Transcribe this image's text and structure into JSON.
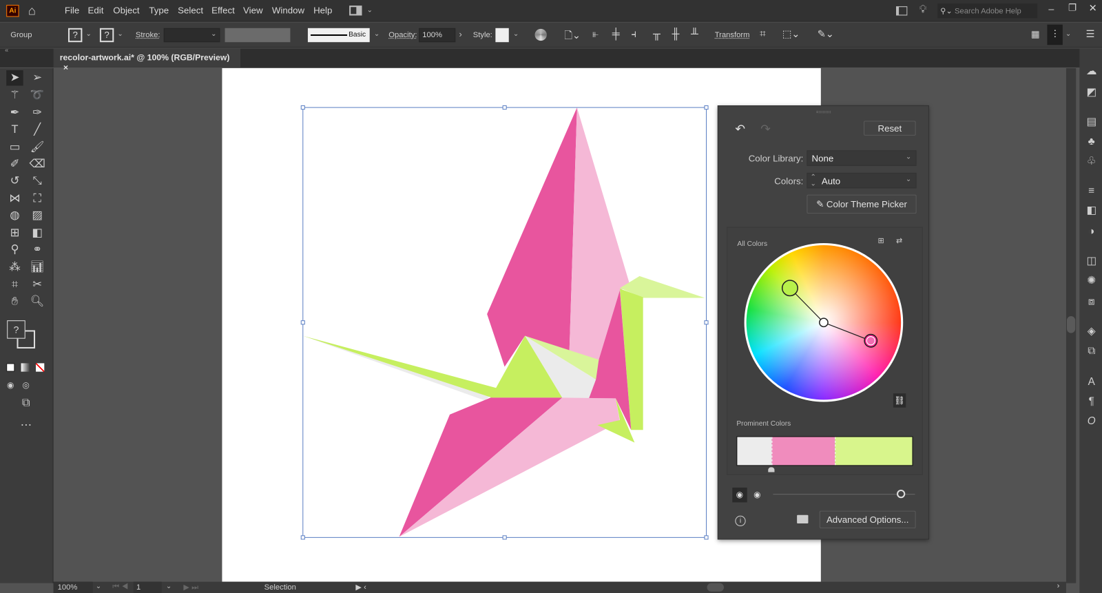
{
  "app": {
    "logo": "Ai"
  },
  "menu": [
    "File",
    "Edit",
    "Object",
    "Type",
    "Select",
    "Effect",
    "View",
    "Window",
    "Help"
  ],
  "window": {
    "search_placeholder": "Search Adobe Help"
  },
  "control": {
    "selection_type": "Group",
    "fill_unknown": "?",
    "stroke_unknown": "?",
    "stroke_label": "Stroke:",
    "brush_label": "Basic",
    "opacity_label": "Opacity:",
    "opacity_value": "100%",
    "style_label": "Style:",
    "transform_label": "Transform"
  },
  "document": {
    "tab_title": "recolor-artwork.ai* @ 100% (RGB/Preview)",
    "close": "×"
  },
  "toolbar": {
    "fill_stroke_unknown": "?"
  },
  "status": {
    "zoom": "100%",
    "artboard": "1",
    "tool": "Selection"
  },
  "recolor": {
    "reset": "Reset",
    "color_library_label": "Color Library:",
    "color_library_value": "None",
    "colors_label": "Colors:",
    "colors_value": "Auto",
    "theme_picker": "Color Theme Picker",
    "all_colors": "All Colors",
    "prominent_colors": "Prominent Colors",
    "prominent": [
      {
        "color": "#ececec",
        "share": 0.2
      },
      {
        "color": "#f08cbd",
        "share": 0.36
      },
      {
        "color": "#d8f58c",
        "share": 0.44
      }
    ],
    "advanced": "Advanced Options..."
  },
  "artwork_colors": {
    "pink_dark": "#e8559e",
    "pink_light": "#f5b8d6",
    "green": "#c6ef5f",
    "green_light": "#d9f59a",
    "gray": "#ebebeb"
  }
}
